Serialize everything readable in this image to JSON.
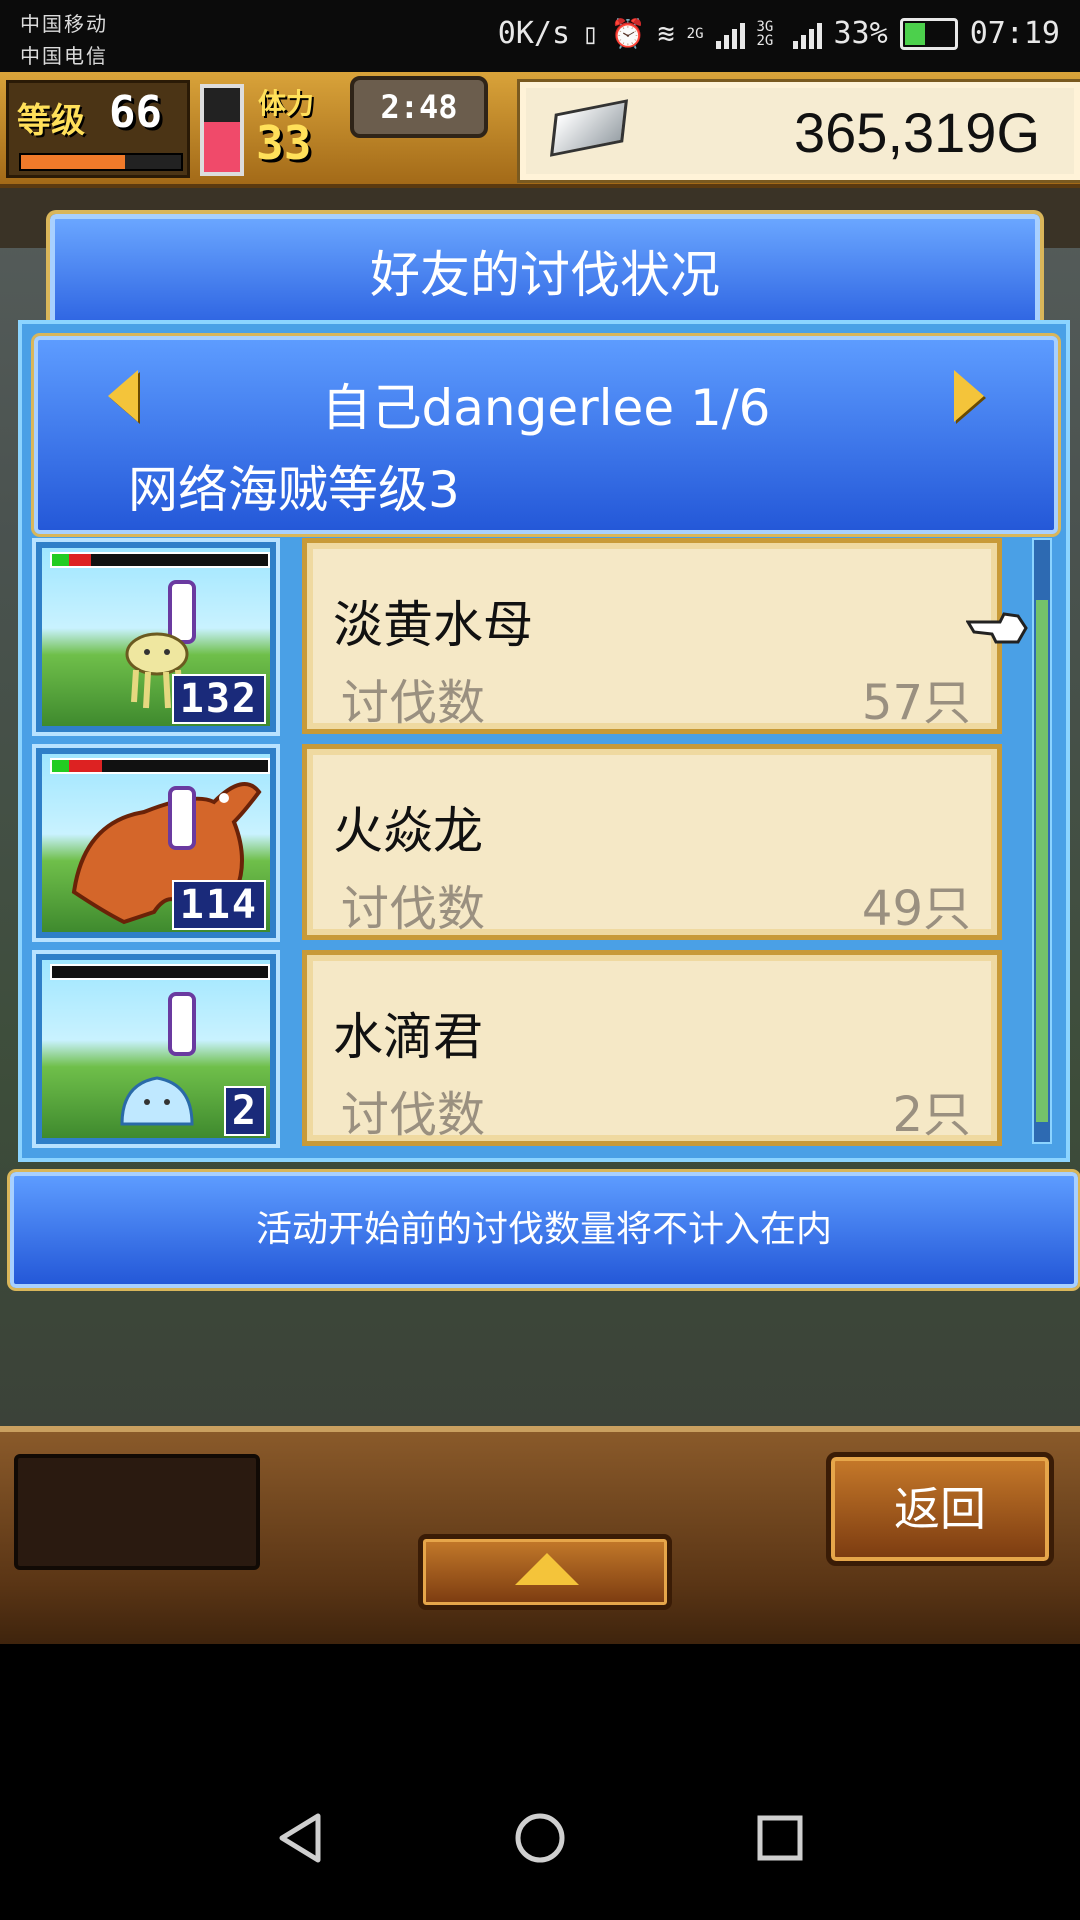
{
  "status_bar": {
    "carrier_1": "中国移动",
    "carrier_2": "中国电信",
    "net_speed": "0K/s",
    "net_types": [
      "2G",
      "3G 2G"
    ],
    "battery": "33%",
    "time": "07:19",
    "icons": [
      "vibrate-icon",
      "alarm-icon",
      "wifi-icon",
      "signal-icon",
      "battery-icon"
    ]
  },
  "hud": {
    "level_label": "等级",
    "level_value": "66",
    "exp_fraction": 0.65,
    "stamina_label": "体力",
    "stamina_value": "33",
    "stamina_fraction": 0.6,
    "timer": "2:48",
    "gold": "365,319G"
  },
  "dialog": {
    "title": "好友的讨伐状况",
    "user_line": "自己dangerlee 1/6",
    "rank_line": "网络海贼等级3",
    "kill_label": "讨伐数",
    "entries": [
      {
        "name": "淡黄水母",
        "kills": "57只",
        "level": "132",
        "hp_red_fraction": 0.1
      },
      {
        "name": "火焱龙",
        "kills": "49只",
        "level": "114",
        "hp_red_fraction": 0.15
      },
      {
        "name": "水滴君",
        "kills": "2只",
        "level": "2",
        "hp_red_fraction": 0.0
      }
    ],
    "notice": "活动开始前的讨伐数量将不计入在内"
  },
  "bottom": {
    "return_label": "返回"
  },
  "colors": {
    "panel_blue": "#2458d8",
    "card_bg": "#f5e8c6",
    "gold_accent": "#f4c43a"
  }
}
